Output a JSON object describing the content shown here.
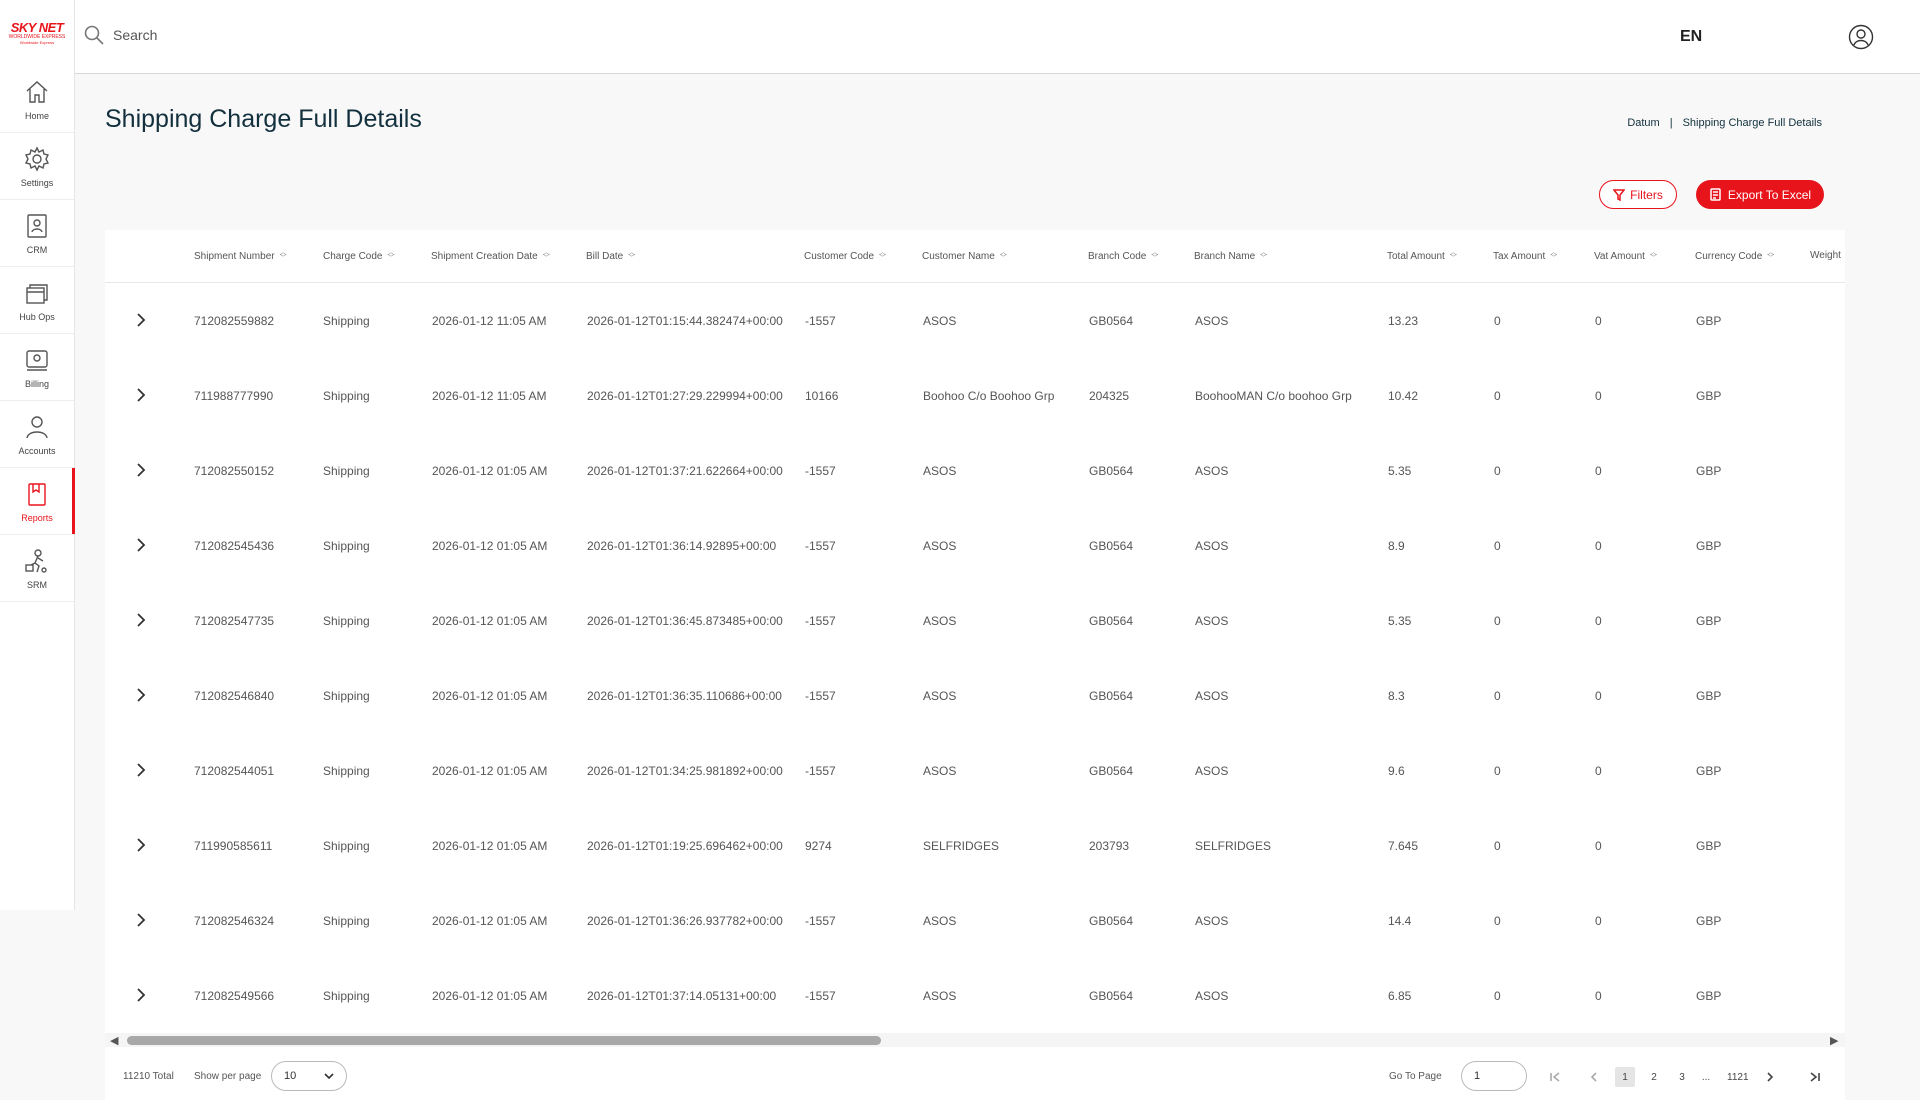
{
  "brand": {
    "logo_main": "SKY NET",
    "logo_sub": "WORLDWIDE EXPRESS",
    "logo_tag": "Worldwide Express"
  },
  "sidebar": {
    "items": [
      {
        "label": "Home",
        "icon": "home-icon"
      },
      {
        "label": "Settings",
        "icon": "gear-icon"
      },
      {
        "label": "CRM",
        "icon": "contact-book-icon"
      },
      {
        "label": "Hub Ops",
        "icon": "stack-icon"
      },
      {
        "label": "Billing",
        "icon": "billing-icon"
      },
      {
        "label": "Accounts",
        "icon": "user-icon"
      },
      {
        "label": "Reports",
        "icon": "report-icon",
        "active": true
      },
      {
        "label": "SRM",
        "icon": "courier-icon"
      }
    ]
  },
  "topbar": {
    "search_placeholder": "Search",
    "language": "EN",
    "user_icon": "user-circle-icon"
  },
  "page": {
    "title": "Shipping Charge Full Details"
  },
  "breadcrumb": {
    "root": "Datum",
    "separator": "|",
    "current": "Shipping Charge Full Details"
  },
  "actions": {
    "filters_label": "Filters",
    "export_label": "Export To Excel"
  },
  "colors": {
    "accent": "#e8141c",
    "title": "#12303d"
  },
  "table": {
    "columns": [
      "Shipment Number",
      "Charge Code",
      "Shipment Creation Date",
      "Bill Date",
      "Customer Code",
      "Customer Name",
      "Branch Code",
      "Branch Name",
      "Total Amount",
      "Tax Amount",
      "Vat Amount",
      "Currency Code",
      "Weight"
    ],
    "rows": [
      [
        "712082559882",
        "Shipping",
        "2026-01-12 11:05 AM",
        "2026-01-12T01:15:44.382474+00:00",
        "-1557",
        "ASOS",
        "GB0564",
        "ASOS",
        "13.23",
        "0",
        "0",
        "GBP",
        ""
      ],
      [
        "711988777990",
        "Shipping",
        "2026-01-12 11:05 AM",
        "2026-01-12T01:27:29.229994+00:00",
        "10166",
        "Boohoo C/o Boohoo Grp",
        "204325",
        "BoohooMAN C/o boohoo Grp",
        "10.42",
        "0",
        "0",
        "GBP",
        ""
      ],
      [
        "712082550152",
        "Shipping",
        "2026-01-12 01:05 AM",
        "2026-01-12T01:37:21.622664+00:00",
        "-1557",
        "ASOS",
        "GB0564",
        "ASOS",
        "5.35",
        "0",
        "0",
        "GBP",
        ""
      ],
      [
        "712082545436",
        "Shipping",
        "2026-01-12 01:05 AM",
        "2026-01-12T01:36:14.92895+00:00",
        "-1557",
        "ASOS",
        "GB0564",
        "ASOS",
        "8.9",
        "0",
        "0",
        "GBP",
        ""
      ],
      [
        "712082547735",
        "Shipping",
        "2026-01-12 01:05 AM",
        "2026-01-12T01:36:45.873485+00:00",
        "-1557",
        "ASOS",
        "GB0564",
        "ASOS",
        "5.35",
        "0",
        "0",
        "GBP",
        ""
      ],
      [
        "712082546840",
        "Shipping",
        "2026-01-12 01:05 AM",
        "2026-01-12T01:36:35.110686+00:00",
        "-1557",
        "ASOS",
        "GB0564",
        "ASOS",
        "8.3",
        "0",
        "0",
        "GBP",
        ""
      ],
      [
        "712082544051",
        "Shipping",
        "2026-01-12 01:05 AM",
        "2026-01-12T01:34:25.981892+00:00",
        "-1557",
        "ASOS",
        "GB0564",
        "ASOS",
        "9.6",
        "0",
        "0",
        "GBP",
        ""
      ],
      [
        "711990585611",
        "Shipping",
        "2026-01-12 01:05 AM",
        "2026-01-12T01:19:25.696462+00:00",
        "9274",
        "SELFRIDGES",
        "203793",
        "SELFRIDGES",
        "7.645",
        "0",
        "0",
        "GBP",
        ""
      ],
      [
        "712082546324",
        "Shipping",
        "2026-01-12 01:05 AM",
        "2026-01-12T01:36:26.937782+00:00",
        "-1557",
        "ASOS",
        "GB0564",
        "ASOS",
        "14.4",
        "0",
        "0",
        "GBP",
        ""
      ],
      [
        "712082549566",
        "Shipping",
        "2026-01-12 01:05 AM",
        "2026-01-12T01:37:14.05131+00:00",
        "-1557",
        "ASOS",
        "GB0564",
        "ASOS",
        "6.85",
        "0",
        "0",
        "GBP",
        ""
      ]
    ]
  },
  "footer": {
    "total": "11210 Total",
    "show_per_page_label": "Show per page",
    "per_page_value": "10",
    "go_to_page_label": "Go To Page",
    "go_to_page_value": "1",
    "pages": [
      "1",
      "2",
      "3",
      "...",
      "1121"
    ],
    "current_page": "1"
  }
}
